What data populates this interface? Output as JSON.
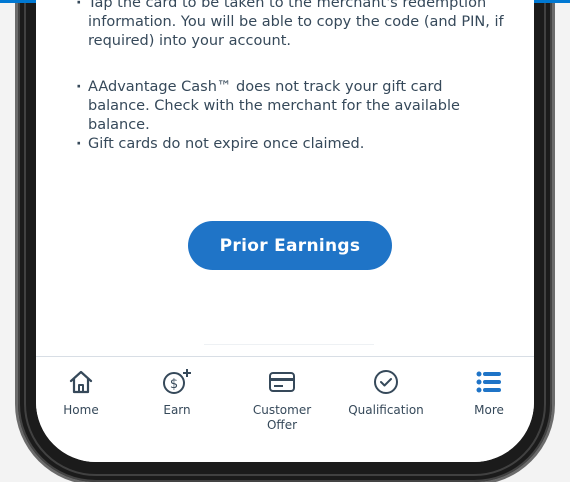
{
  "info": {
    "bullet_1": "Tap the card to be taken to the merchant's redemption information. You will be able to copy the code (and PIN, if required) into your account.",
    "bullet_2": "AAdvantage Cash™ does not track your gift card balance. Check with the merchant for the available balance.",
    "bullet_3": "Gift cards do not expire once claimed.",
    "bullet_marker": "·"
  },
  "prior_earnings_label": "Prior Earnings",
  "tabbar": {
    "accent": "#1f74c7",
    "items": [
      {
        "label": "Home",
        "icon": "home-icon"
      },
      {
        "label": "Earn",
        "icon": "dollar-plus-icon"
      },
      {
        "label": "Customer\nOffer",
        "icon": "card-icon"
      },
      {
        "label": "Qualification",
        "icon": "check-circle-icon"
      },
      {
        "label": "More",
        "icon": "list-icon"
      }
    ]
  }
}
